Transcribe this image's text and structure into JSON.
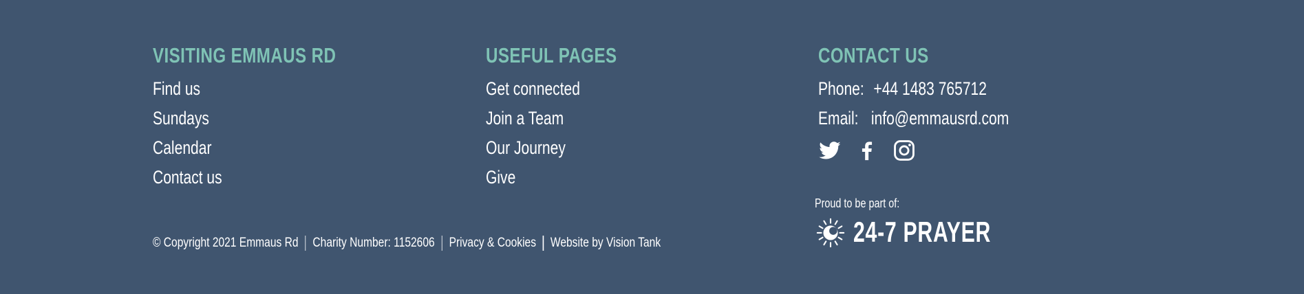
{
  "visiting": {
    "heading": "VISITING EMMAUS RD",
    "links": [
      "Find us",
      "Sundays",
      "Calendar",
      "Contact us"
    ]
  },
  "useful": {
    "heading": "USEFUL PAGES",
    "links": [
      "Get connected",
      "Join a Team",
      "Our Journey",
      "Give"
    ]
  },
  "contact": {
    "heading": "CONTACT US",
    "phone_label": "Phone:",
    "phone_value": "+44 1483 765712",
    "email_label": "Email:",
    "email_value": "info@emmausrd.com",
    "socials": [
      "twitter-icon",
      "facebook-icon",
      "instagram-icon"
    ]
  },
  "partner": {
    "proud_text": "Proud to be part of:",
    "logo_text": "24-7 PRAYER"
  },
  "footer": {
    "copyright": "© Copyright 2021 Emmaus Rd",
    "charity": "Charity Number: 1152606",
    "privacy": "Privacy & Cookies",
    "credit": "Website by Vision Tank"
  },
  "colors": {
    "background": "#40556f",
    "heading": "#7fc3b5",
    "text": "#ffffff"
  }
}
